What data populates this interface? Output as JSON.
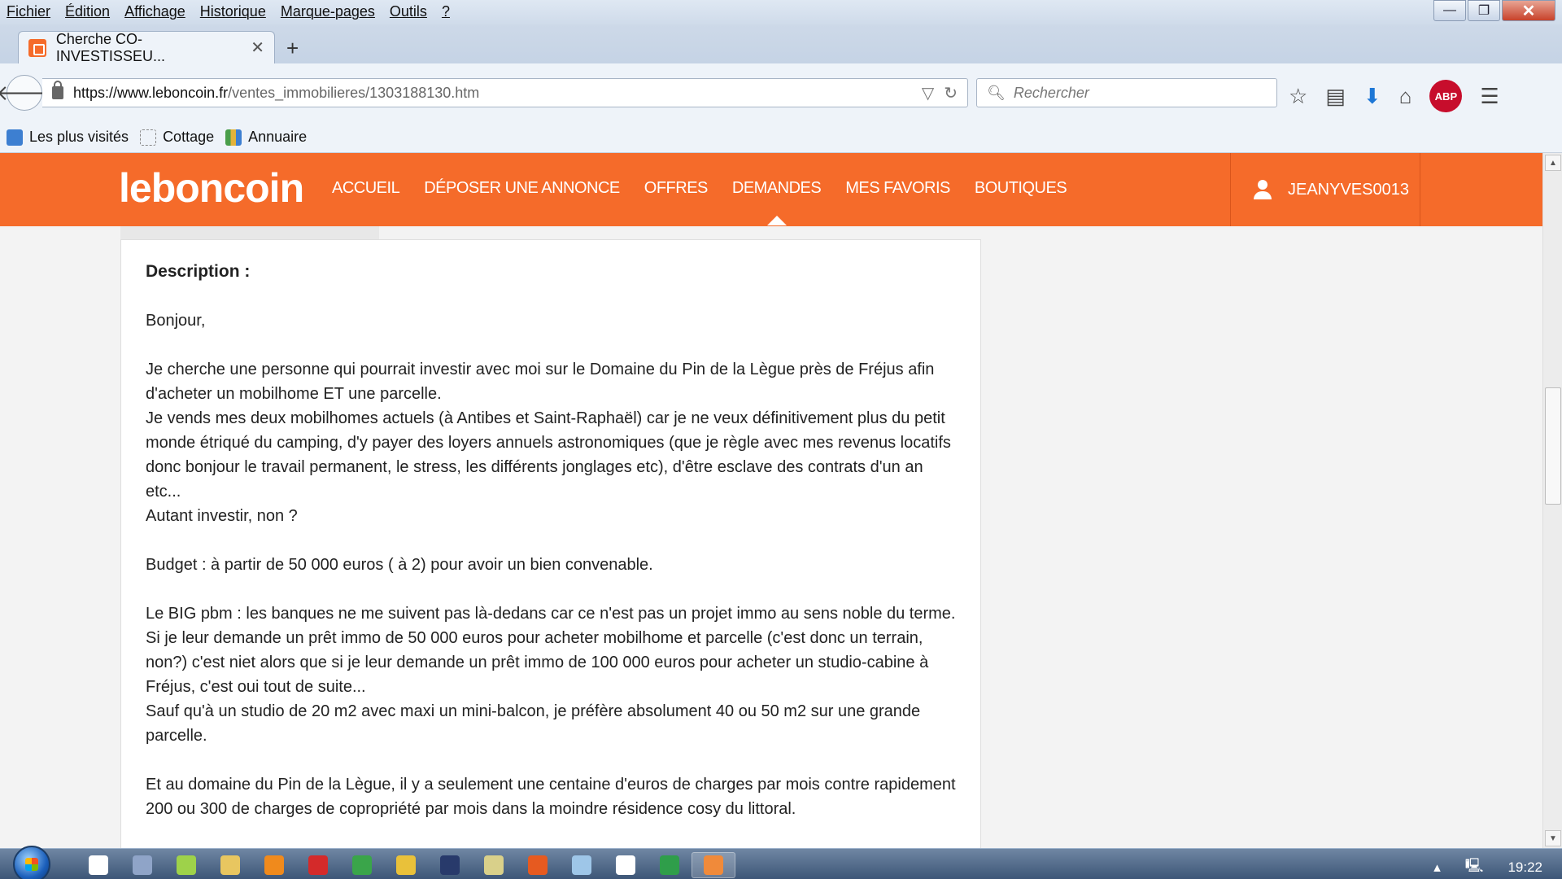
{
  "menubar": {
    "items": [
      "Fichier",
      "Édition",
      "Affichage",
      "Historique",
      "Marque-pages",
      "Outils",
      "?"
    ],
    "window_buttons": {
      "minimize": "—",
      "maximize": "❐",
      "close": "✕"
    }
  },
  "tab": {
    "title": "Cherche CO-INVESTISSEU...",
    "close": "✕",
    "new_tab": "+"
  },
  "navbar": {
    "url_host": "https://www.leboncoin.fr",
    "url_path": "/ventes_immobilieres/1303188130.htm",
    "search_placeholder": "Rechercher",
    "abp_label": "ABP"
  },
  "bookmarks": [
    {
      "label": "Les plus visités",
      "color": "#3d7fd1"
    },
    {
      "label": "Cottage",
      "color": "#ffffff"
    },
    {
      "label": "Annuaire",
      "color": "#4a9e4a"
    }
  ],
  "site": {
    "logo": "leboncoin",
    "brand_color": "#f56b2a",
    "nav": [
      "ACCUEIL",
      "DÉPOSER UNE ANNONCE",
      "OFFRES",
      "DEMANDES",
      "MES FAVORIS",
      "BOUTIQUES"
    ],
    "active_nav": "DEMANDES",
    "username": "JEANYVES0013"
  },
  "description": {
    "heading": "Description :",
    "paragraphs": [
      "Bonjour,",
      "Je cherche une personne qui pourrait investir avec moi sur le Domaine du Pin de la Lègue près de Fréjus afin d'acheter un mobilhome ET une parcelle.\nJe vends mes deux mobilhomes actuels (à Antibes et Saint-Raphaël) car je ne veux définitivement plus du petit monde étriqué du camping, d'y payer des loyers annuels astronomiques (que je règle avec mes revenus locatifs donc bonjour le travail permanent, le stress, les différents jonglages etc), d'être esclave des contrats d'un an etc...\nAutant investir, non ?",
      "Budget : à partir de 50 000 euros ( à 2) pour avoir un bien convenable.",
      "Le BIG pbm : les banques ne me suivent pas là-dedans car ce n'est pas un projet immo au sens noble du terme.\nSi je leur demande un prêt immo de 50 000 euros pour acheter mobilhome et parcelle (c'est donc un terrain, non?) c'est niet alors que si je leur demande un prêt immo de 100 000 euros pour acheter un studio-cabine à Fréjus, c'est oui tout de suite...\nSauf qu'à un studio de 20 m2 avec maxi un mini-balcon, je préfère absolument 40 ou 50 m2 sur une grande parcelle.",
      "Et au domaine du Pin de la Lègue, il y a seulement une centaine d'euros de charges par mois contre rapidement 200 ou 300 de charges de copropriété par mois dans la moindre résidence cosy du littoral."
    ]
  },
  "taskbar": {
    "icon_colors": [
      "#ffffff",
      "#8fa4c8",
      "#9ed24a",
      "#e8c660",
      "#f08a1c",
      "#d42a2a",
      "#3aa54a",
      "#e9c13a",
      "#283a6b",
      "#d9d08a",
      "#e65a20",
      "#9ec6e8",
      "#ffffff",
      "#2f9e4a",
      "#f08a3a"
    ],
    "selected_index": 14,
    "clock": "19:22"
  }
}
